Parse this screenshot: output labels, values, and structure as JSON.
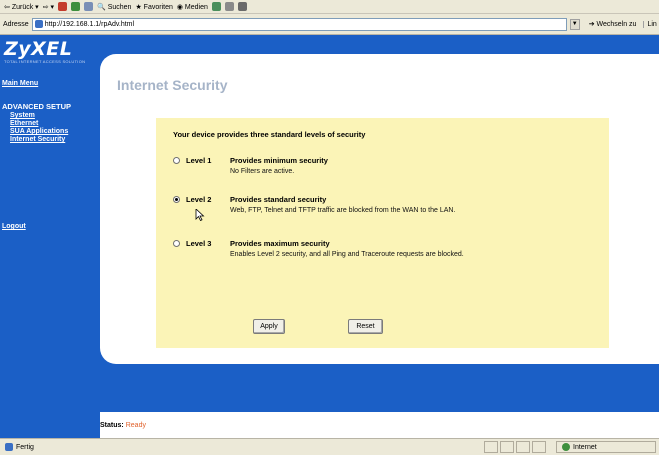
{
  "toolbar": {
    "back": "Zurück",
    "search": "Suchen",
    "favorites": "Favoriten",
    "media": "Medien"
  },
  "address": {
    "label": "Adresse",
    "url": "http://192.168.1.1/rpAdv.html",
    "go": "Wechseln zu",
    "links": "Lin"
  },
  "brand": {
    "logo": "ZyXEL",
    "tagline": "TOTAL INTERNET ACCESS SOLUTION"
  },
  "sidebar": {
    "main_menu": "Main Menu",
    "section": "ADVANCED SETUP",
    "items": [
      {
        "label": "System"
      },
      {
        "label": "Ethernet"
      },
      {
        "label": "SUA Applications"
      },
      {
        "label": "Internet Security"
      }
    ],
    "logout": "Logout"
  },
  "main": {
    "title": "Internet Security",
    "intro": "Your device provides three standard levels of security",
    "levels": [
      {
        "name": "Level 1",
        "title": "Provides minimum security",
        "desc": "No Filters are active.",
        "selected": false
      },
      {
        "name": "Level 2",
        "title": "Provides standard security",
        "desc": "Web, FTP, Telnet and TFTP traffic are blocked from the WAN to the LAN.",
        "selected": true
      },
      {
        "name": "Level 3",
        "title": "Provides maximum security",
        "desc": "Enables Level 2 security, and all Ping and Traceroute requests are blocked.",
        "selected": false
      }
    ],
    "apply": "Apply",
    "reset": "Reset"
  },
  "status": {
    "label": "Status:",
    "value": "Ready"
  },
  "browser_status": {
    "done": "Fertig",
    "zone": "Internet"
  },
  "colors": {
    "page_blue": "#1b5fc6",
    "panel_yellow": "#fbf4b7",
    "title_grey": "#a6b4c8",
    "status_orange": "#e0612b"
  }
}
